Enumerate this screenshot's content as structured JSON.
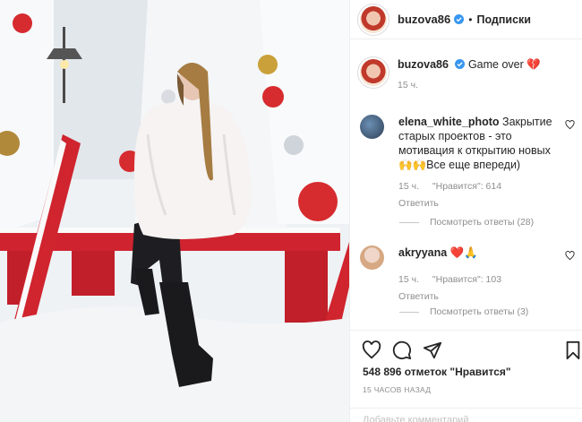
{
  "post": {
    "photo_alt": "",
    "header": {
      "username": "buzova86",
      "separator": "•",
      "follow_label": "Подписки"
    },
    "caption": {
      "username": "buzova86",
      "text": "Game over 💔",
      "time": "15 ч."
    },
    "comments": [
      {
        "username": "elena_white_photo",
        "text": "Закрытие старых проектов - это мотивация к открытию новых 🙌🙌Все еще впереди)",
        "time": "15 ч.",
        "likes": "\"Нравится\": 614",
        "reply_label": "Ответить",
        "view_replies": "Посмотреть ответы (28)"
      },
      {
        "username": "akryyana",
        "text": "❤️🙏",
        "time": "15 ч.",
        "likes": "\"Нравится\": 103",
        "reply_label": "Ответить",
        "view_replies": "Посмотреть ответы (3)"
      }
    ],
    "likes_text": "548 896 отметок \"Нравится\"",
    "posted_ago": "15 ЧАСОВ НАЗАД",
    "add_comment_placeholder": "Добавьте комментарий..."
  },
  "icons": [
    "verified-icon",
    "heart-icon",
    "comment-icon",
    "share-icon",
    "bookmark-icon",
    "comment-heart-icon"
  ],
  "colors": {
    "verified": "#3897f0",
    "text": "#262626",
    "muted": "#8e8e8e",
    "border": "#efefef",
    "bench": "#d0242e"
  }
}
